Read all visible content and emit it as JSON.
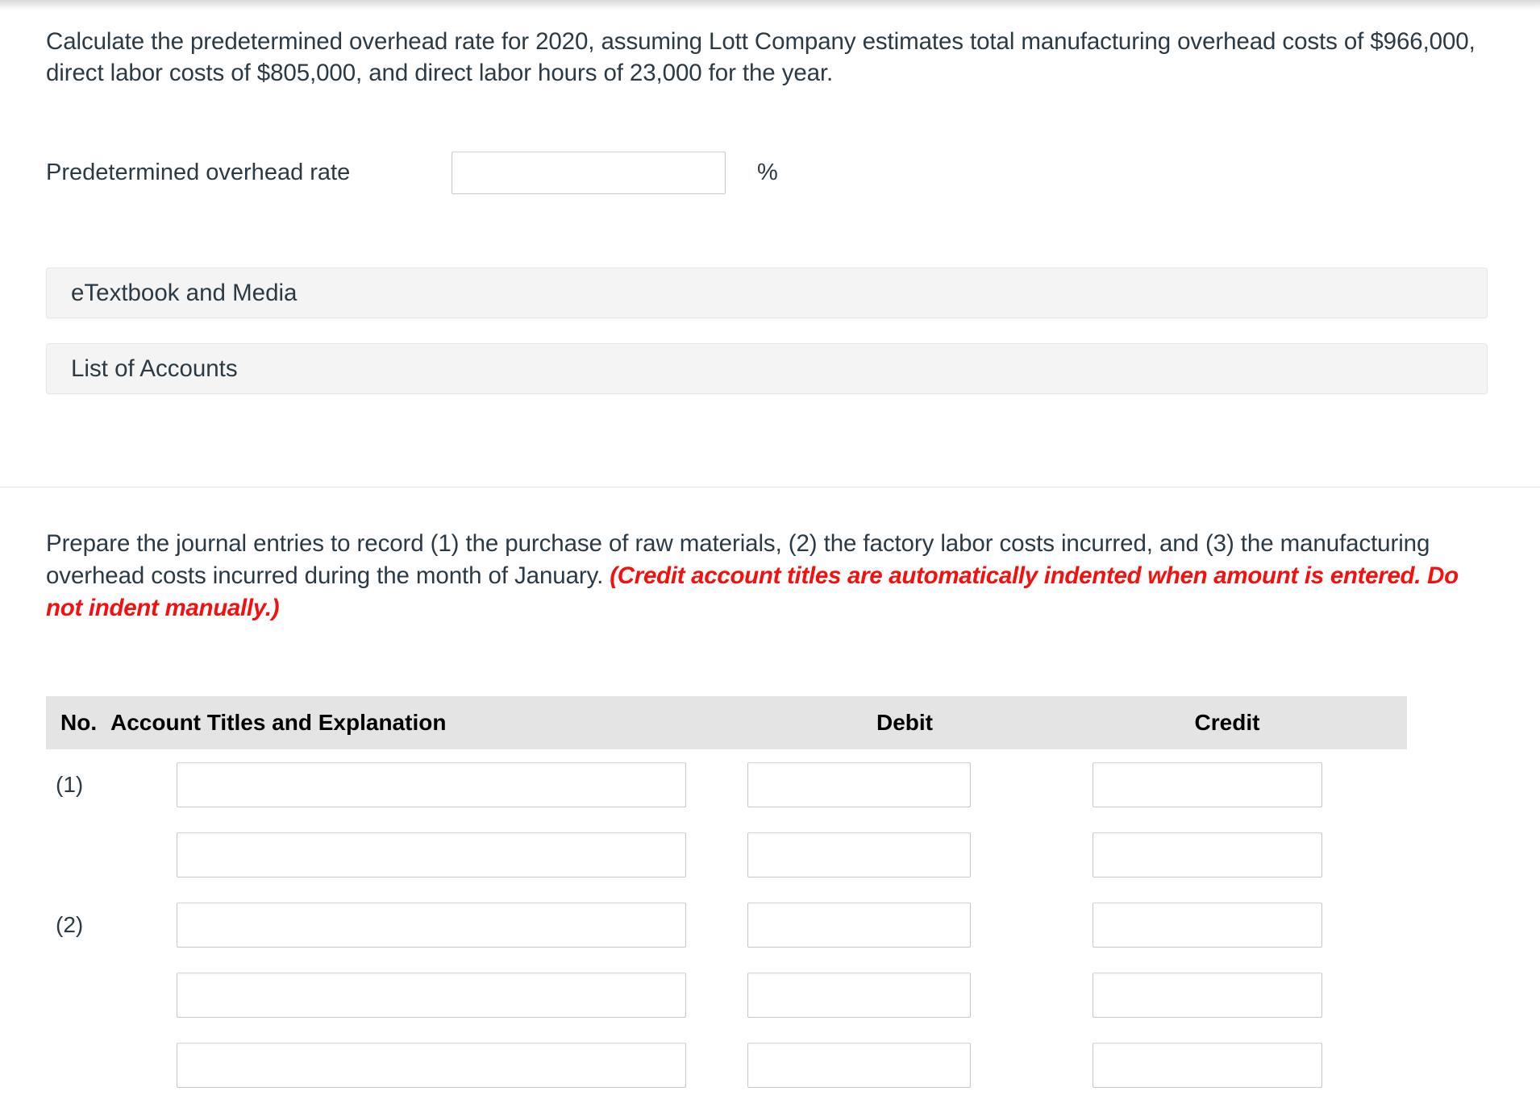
{
  "question1": {
    "prompt": "Calculate the predetermined overhead rate for 2020, assuming Lott Company estimates total manufacturing overhead costs of $966,000, direct labor costs of $805,000, and direct labor hours of 23,000 for the year.",
    "rate_label": "Predetermined overhead rate",
    "rate_value": "",
    "percent_symbol": "%"
  },
  "panels": [
    {
      "label": "eTextbook and Media"
    },
    {
      "label": "List of Accounts"
    }
  ],
  "question2": {
    "prompt_part1": "Prepare the journal entries to record (1) the purchase of raw materials, (2) the factory labor costs incurred, and (3) the manufacturing overhead costs incurred during the month of January. ",
    "prompt_red": "(Credit account titles are automatically indented when amount is entered. Do not indent manually.)"
  },
  "journal_table": {
    "headers": {
      "no": "No.",
      "account": "Account Titles and Explanation",
      "debit": "Debit",
      "credit": "Credit"
    },
    "rows": [
      {
        "no": "(1)",
        "account": "",
        "debit": "",
        "credit": ""
      },
      {
        "no": "",
        "account": "",
        "debit": "",
        "credit": ""
      },
      {
        "no": "(2)",
        "account": "",
        "debit": "",
        "credit": ""
      },
      {
        "no": "",
        "account": "",
        "debit": "",
        "credit": ""
      },
      {
        "no": "",
        "account": "",
        "debit": "",
        "credit": ""
      }
    ]
  },
  "colors": {
    "text": "#2b3a44",
    "red_note": "#f60f0f",
    "panel_bg": "#f4f4f4",
    "table_header_bg": "#e4e4e4"
  }
}
